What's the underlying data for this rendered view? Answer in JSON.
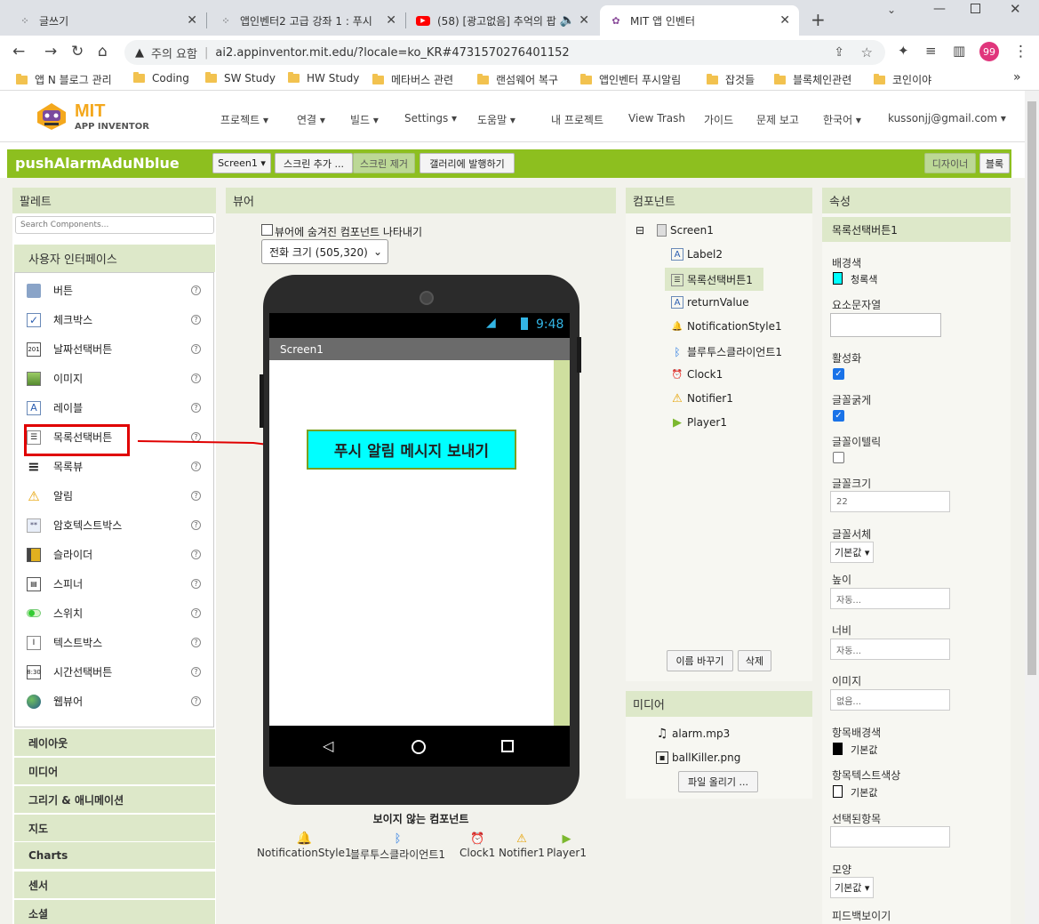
{
  "browser": {
    "tabs": [
      {
        "title": "글쓰기"
      },
      {
        "title": "앱인벤터2 고급 강좌 1 : 푸시"
      },
      {
        "title": "(58) [광고없음] 추억의 팝"
      },
      {
        "title": "MIT 앱 인벤터"
      }
    ],
    "new_tab": "+",
    "security_label": "주의 요함",
    "url": "ai2.appinventor.mit.edu/?locale=ko_KR#4731570276401152",
    "profile_initials": "99",
    "bookmarks": [
      "앱 N 블로그 관리",
      "Coding",
      "SW Study",
      "HW Study",
      "메타버스 관련",
      "랜섬웨어 복구",
      "앱인벤터 푸시알림",
      "잡것들",
      "블록체인관련",
      "코인이야"
    ],
    "bookmarks_more": "»"
  },
  "app": {
    "logo_title": "MIT",
    "logo_subtitle": "APP INVENTOR",
    "menus": [
      "프로젝트 ▾",
      "연결 ▾",
      "빌드 ▾",
      "Settings ▾",
      "도움말 ▾",
      "내 프로젝트",
      "View Trash",
      "가이드",
      "문제 보고",
      "한국어 ▾",
      "kussonjj@gmail.com ▾"
    ],
    "project_name": "pushAlarmAduNblue",
    "screen_select": "Screen1 ▾",
    "add_screen": "스크린 추가 ...",
    "remove_screen": "스크린 제거",
    "publish": "갤러리에 발행하기",
    "designer": "디자이너",
    "blocks": "블록"
  },
  "palette": {
    "title": "팔레트",
    "search_placeholder": "Search Components...",
    "category_open": "사용자 인터페이스",
    "items": [
      "버튼",
      "체크박스",
      "날짜선택버튼",
      "이미지",
      "레이블",
      "목록선택버튼",
      "목록뷰",
      "알림",
      "암호텍스트박스",
      "슬라이더",
      "스피너",
      "스위치",
      "텍스트박스",
      "시간선택버튼",
      "웹뷰어"
    ],
    "categories": [
      "레이아웃",
      "미디어",
      "그리기 & 애니메이션",
      "지도",
      "Charts",
      "센서",
      "소셜"
    ]
  },
  "viewer": {
    "title": "뷰어",
    "hidden_checkbox_label": "뷰어에 숨겨진 컴포넌트 나타내기",
    "size_select": "전화 크기 (505,320)",
    "status_time": "9:48",
    "screen_title": "Screen1",
    "picker_button": "푸시 알림 메시지 보내기",
    "nonvisible_title": "보이지 않는 컴포넌트",
    "nonvisible": [
      "NotificationStyle1",
      "블루투스클라이언트1",
      "Clock1",
      "Notifier1",
      "Player1"
    ]
  },
  "components": {
    "title": "컴포넌트",
    "root": "Screen1",
    "collapse": "⊟",
    "children": [
      "Label2",
      "목록선택버튼1",
      "returnValue",
      "NotificationStyle1",
      "블루투스클라이언트1",
      "Clock1",
      "Notifier1",
      "Player1"
    ],
    "rename": "이름 바꾸기",
    "delete": "삭제"
  },
  "media": {
    "title": "미디어",
    "files": [
      "alarm.mp3",
      "ballKiller.png"
    ],
    "upload": "파일 올리기 ..."
  },
  "properties": {
    "title": "속성",
    "component": "목록선택버튼1",
    "bg_label": "배경색",
    "bg_value": "청록색",
    "bg_color": "#00ffff",
    "elements_label": "요소문자열",
    "enabled_label": "활성화",
    "bold_label": "글꼴굵게",
    "italic_label": "글꼴이텔릭",
    "fontsize_label": "글꼴크기",
    "fontsize_value": "22",
    "typeface_label": "글꼴서체",
    "typeface_value": "기본값 ▾",
    "height_label": "높이",
    "height_value": "자동...",
    "width_label": "너비",
    "width_value": "자동...",
    "image_label": "이미지",
    "image_value": "없음...",
    "itembg_label": "항목배경색",
    "itembg_value": "기본값",
    "itemtext_label": "항목텍스트색상",
    "itemtext_value": "기본값",
    "selection_label": "선택된항목",
    "shape_label": "모양",
    "shape_value": "기본값 ▾",
    "feedback_label": "피드백보이기"
  },
  "colors": {
    "accent_green": "#8dbf1f",
    "panel_header": "#dde8c9",
    "annotation_red": "#e00000"
  }
}
